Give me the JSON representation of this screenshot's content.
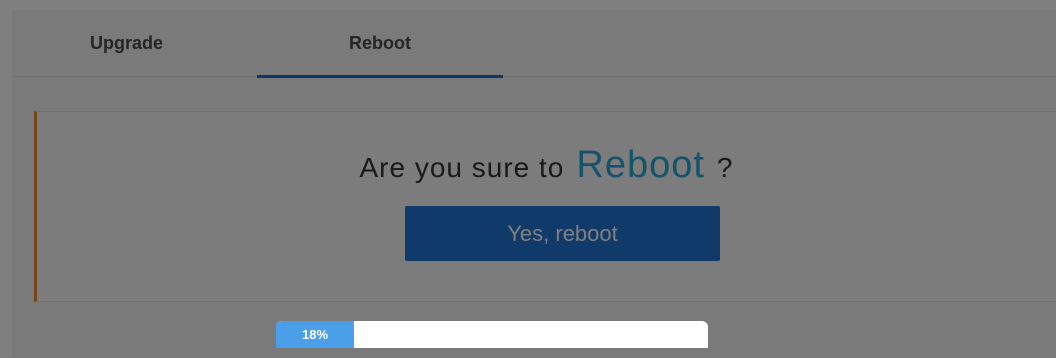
{
  "tabs": [
    {
      "label": "Upgrade",
      "active": false
    },
    {
      "label": "Reboot",
      "active": true
    }
  ],
  "dialog": {
    "question_prefix": "Are you sure to",
    "question_highlight": "Reboot",
    "question_suffix": "?",
    "confirm_label": "Yes, reboot"
  },
  "progress": {
    "value": 0.18,
    "label": "18%"
  },
  "colors": {
    "accent": "#1f74d4",
    "highlight_text": "#2aa6d9",
    "panel_border": "#e88f2a",
    "tab_underline": "#1e6fc8",
    "progress_fill": "#4a9fe8"
  }
}
